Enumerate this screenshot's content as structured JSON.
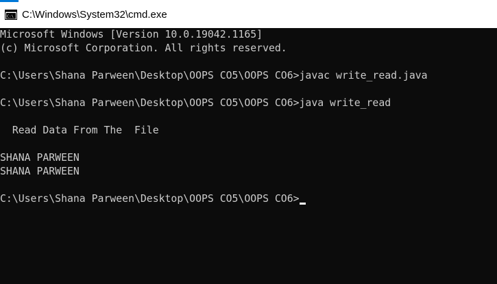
{
  "window": {
    "title": "C:\\Windows\\System32\\cmd.exe",
    "icon": "cmd-icon",
    "accent_color": "#0078d7"
  },
  "console": {
    "background": "#0c0c0c",
    "text_color": "#cccccc",
    "lines": {
      "version": "Microsoft Windows [Version 10.0.19042.1165]",
      "copyright": "(c) Microsoft Corporation. All rights reserved.",
      "cmd_javac": "C:\\Users\\Shana Parween\\Desktop\\OOPS CO5\\OOPS CO6>javac write_read.java",
      "cmd_java": "C:\\Users\\Shana Parween\\Desktop\\OOPS CO5\\OOPS CO6>java write_read",
      "output_header": "  Read Data From The  File",
      "output_1": "SHANA PARWEEN",
      "output_2": "SHANA PARWEEN",
      "prompt": "C:\\Users\\Shana Parween\\Desktop\\OOPS CO5\\OOPS CO6>"
    }
  }
}
